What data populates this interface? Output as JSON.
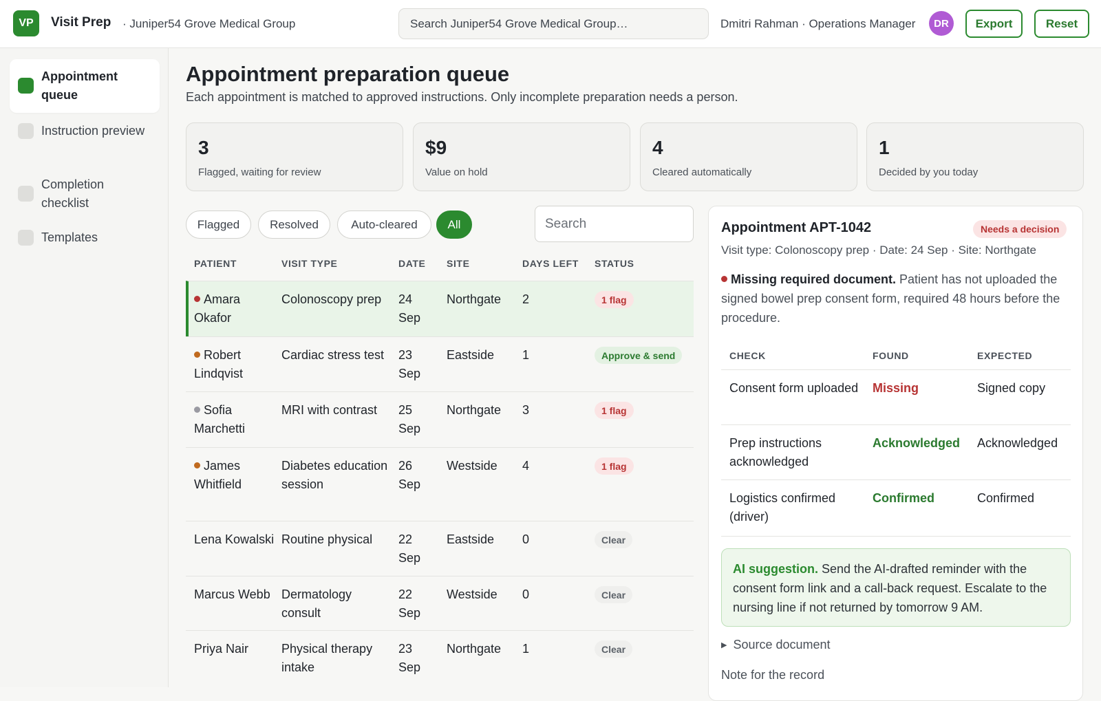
{
  "header": {
    "logo": "VP",
    "app_title": "Visit Prep",
    "org": "· Juniper54 Grove Medical Group",
    "search_placeholder": "Search Juniper54 Grove Medical Group…",
    "user": "Dmitri Rahman · Operations Manager",
    "avatar_initials": "DR",
    "export_label": "Export",
    "reset_label": "Reset"
  },
  "sidebar": {
    "items": [
      {
        "label": "Appointment queue",
        "active": true
      },
      {
        "label": "Instruction preview",
        "active": false
      },
      {
        "label": "Completion checklist",
        "active": false
      },
      {
        "label": "Templates",
        "active": false
      }
    ]
  },
  "main": {
    "title": "Appointment preparation queue",
    "subtitle": "Each appointment is matched to approved instructions. Only incomplete preparation needs a person."
  },
  "kpis": [
    {
      "value": "3",
      "label": "Flagged, waiting for review"
    },
    {
      "value": "$9",
      "label": "Value on hold"
    },
    {
      "value": "4",
      "label": "Cleared automatically"
    },
    {
      "value": "1",
      "label": "Decided by you today"
    }
  ],
  "filters": [
    {
      "label": "Flagged",
      "active": false
    },
    {
      "label": "Resolved",
      "active": false
    },
    {
      "label": "Auto-cleared",
      "active": false
    },
    {
      "label": "All",
      "active": true
    }
  ],
  "table_search_placeholder": "Search",
  "table": {
    "columns": [
      "PATIENT",
      "VISIT TYPE",
      "DATE",
      "SITE",
      "DAYS LEFT",
      "STATUS"
    ],
    "rows": [
      {
        "patient": "Amara Okafor",
        "visit_type": "Colonoscopy prep",
        "date": "24 Sep",
        "site": "Northgate",
        "days_left": "2",
        "status": "1 flag",
        "status_kind": "flag",
        "dot_color": "#b73434",
        "selected": true
      },
      {
        "patient": "Robert Lindqvist",
        "visit_type": "Cardiac stress test",
        "date": "23 Sep",
        "site": "Eastside",
        "days_left": "1",
        "status": "Approve & send",
        "status_kind": "approve",
        "dot_color": "#c06a1f",
        "selected": false
      },
      {
        "patient": "Sofia Marchetti",
        "visit_type": "MRI with contrast",
        "date": "25 Sep",
        "site": "Northgate",
        "days_left": "3",
        "status": "1 flag",
        "status_kind": "flag",
        "dot_color": "#9a9aa2",
        "selected": false
      },
      {
        "patient": "James Whitfield",
        "visit_type": "Diabetes education session",
        "date": "26 Sep",
        "site": "Westside",
        "days_left": "4",
        "status": "1 flag",
        "status_kind": "flag",
        "dot_color": "#c06a1f",
        "selected": false
      },
      {
        "patient": "Lena Kowalski",
        "visit_type": "Routine physical",
        "date": "22 Sep",
        "site": "Eastside",
        "days_left": "0",
        "status": "Clear",
        "status_kind": "clear",
        "dot_color": "",
        "selected": false
      },
      {
        "patient": "Marcus Webb",
        "visit_type": "Dermatology consult",
        "date": "22 Sep",
        "site": "Westside",
        "days_left": "0",
        "status": "Clear",
        "status_kind": "clear",
        "dot_color": "",
        "selected": false
      },
      {
        "patient": "Priya Nair",
        "visit_type": "Physical therapy intake",
        "date": "23 Sep",
        "site": "Northgate",
        "days_left": "1",
        "status": "Clear",
        "status_kind": "clear",
        "dot_color": "",
        "selected": false
      }
    ]
  },
  "detail": {
    "title": "Appointment APT-1042",
    "badge": "Needs a decision",
    "meta": "Visit type: Colonoscopy prep · Date: 24 Sep · Site: Northgate",
    "issue_title": "Missing required document.",
    "issue_text": " Patient has not uploaded the signed bowel prep consent form, required 48 hours before the procedure.",
    "check_columns": [
      "CHECK",
      "FOUND",
      "EXPECTED"
    ],
    "checks": [
      {
        "check": "Consent form uploaded",
        "found": "Missing",
        "found_kind": "missing",
        "expected": "Signed copy"
      },
      {
        "check": "Prep instructions acknowledged",
        "found": "Acknowledged",
        "found_kind": "ok",
        "expected": "Acknowledged"
      },
      {
        "check": "Logistics confirmed (driver)",
        "found": "Confirmed",
        "found_kind": "ok",
        "expected": "Confirmed"
      }
    ],
    "ai_label": "AI suggestion.",
    "ai_text": " Send the AI-drafted reminder with the consent form link and a call-back request. Escalate to the nursing line if not returned by tomorrow 9 AM.",
    "source_label": "Source document",
    "note_label": "Note for the record"
  }
}
